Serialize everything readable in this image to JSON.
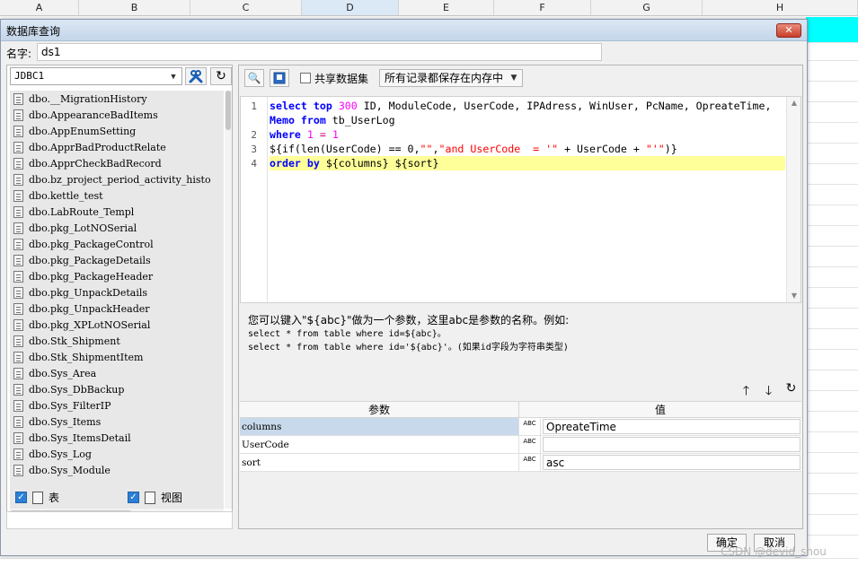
{
  "sheet": {
    "columns": [
      "A",
      "B",
      "C",
      "D",
      "E",
      "F",
      "G",
      "H"
    ],
    "selected_column": "D"
  },
  "dialog": {
    "title": "数据库查询",
    "close_label": "✕",
    "name_label": "名字:",
    "name_value": "ds1",
    "connection": "JDBC1",
    "tables": [
      "dbo.__MigrationHistory",
      "dbo.AppearanceBadItems",
      "dbo.AppEnumSetting",
      "dbo.ApprBadProductRelate",
      "dbo.ApprCheckBadRecord",
      "dbo.bz_project_period_activity_histo",
      "dbo.kettle_test",
      "dbo.LabRoute_Templ",
      "dbo.pkg_LotNOSerial",
      "dbo.pkg_PackageControl",
      "dbo.pkg_PackageDetails",
      "dbo.pkg_PackageHeader",
      "dbo.pkg_UnpackDetails",
      "dbo.pkg_UnpackHeader",
      "dbo.pkg_XPLotNOSerial",
      "dbo.Stk_Shipment",
      "dbo.Stk_ShipmentItem",
      "dbo.Sys_Area",
      "dbo.Sys_DbBackup",
      "dbo.Sys_FilterIP",
      "dbo.Sys_Items",
      "dbo.Sys_ItemsDetail",
      "dbo.Sys_Log",
      "dbo.Sys_Module"
    ],
    "filter_table_label": "表",
    "filter_view_label": "视图",
    "share_label": "共享数据集",
    "memory_option": "所有记录都保存在内存中",
    "line_numbers": [
      "1",
      "2",
      "3",
      "4"
    ],
    "help_text": "您可以键入\"${abc}\"做为一个参数，这里abc是参数的名称。例如:",
    "help_example1": "select * from table where id=${abc}。",
    "help_example2": "select * from table where id='${abc}'。(如果id字段为字符串类型)",
    "param_header": "参数",
    "value_header": "值",
    "type_label_top": "ABC",
    "params": [
      {
        "name": "columns",
        "value": "OpreateTime"
      },
      {
        "name": "UserCode",
        "value": ""
      },
      {
        "name": "sort",
        "value": "asc"
      }
    ],
    "ok_label": "确定",
    "cancel_label": "取消"
  },
  "watermark": "CSDN @devid_shou",
  "colors": {
    "cyan_cell": "#00ffff",
    "keyword": "#0000ff",
    "string": "#ff0000",
    "number": "#ff00ff",
    "highlight_line": "#ffff99"
  }
}
